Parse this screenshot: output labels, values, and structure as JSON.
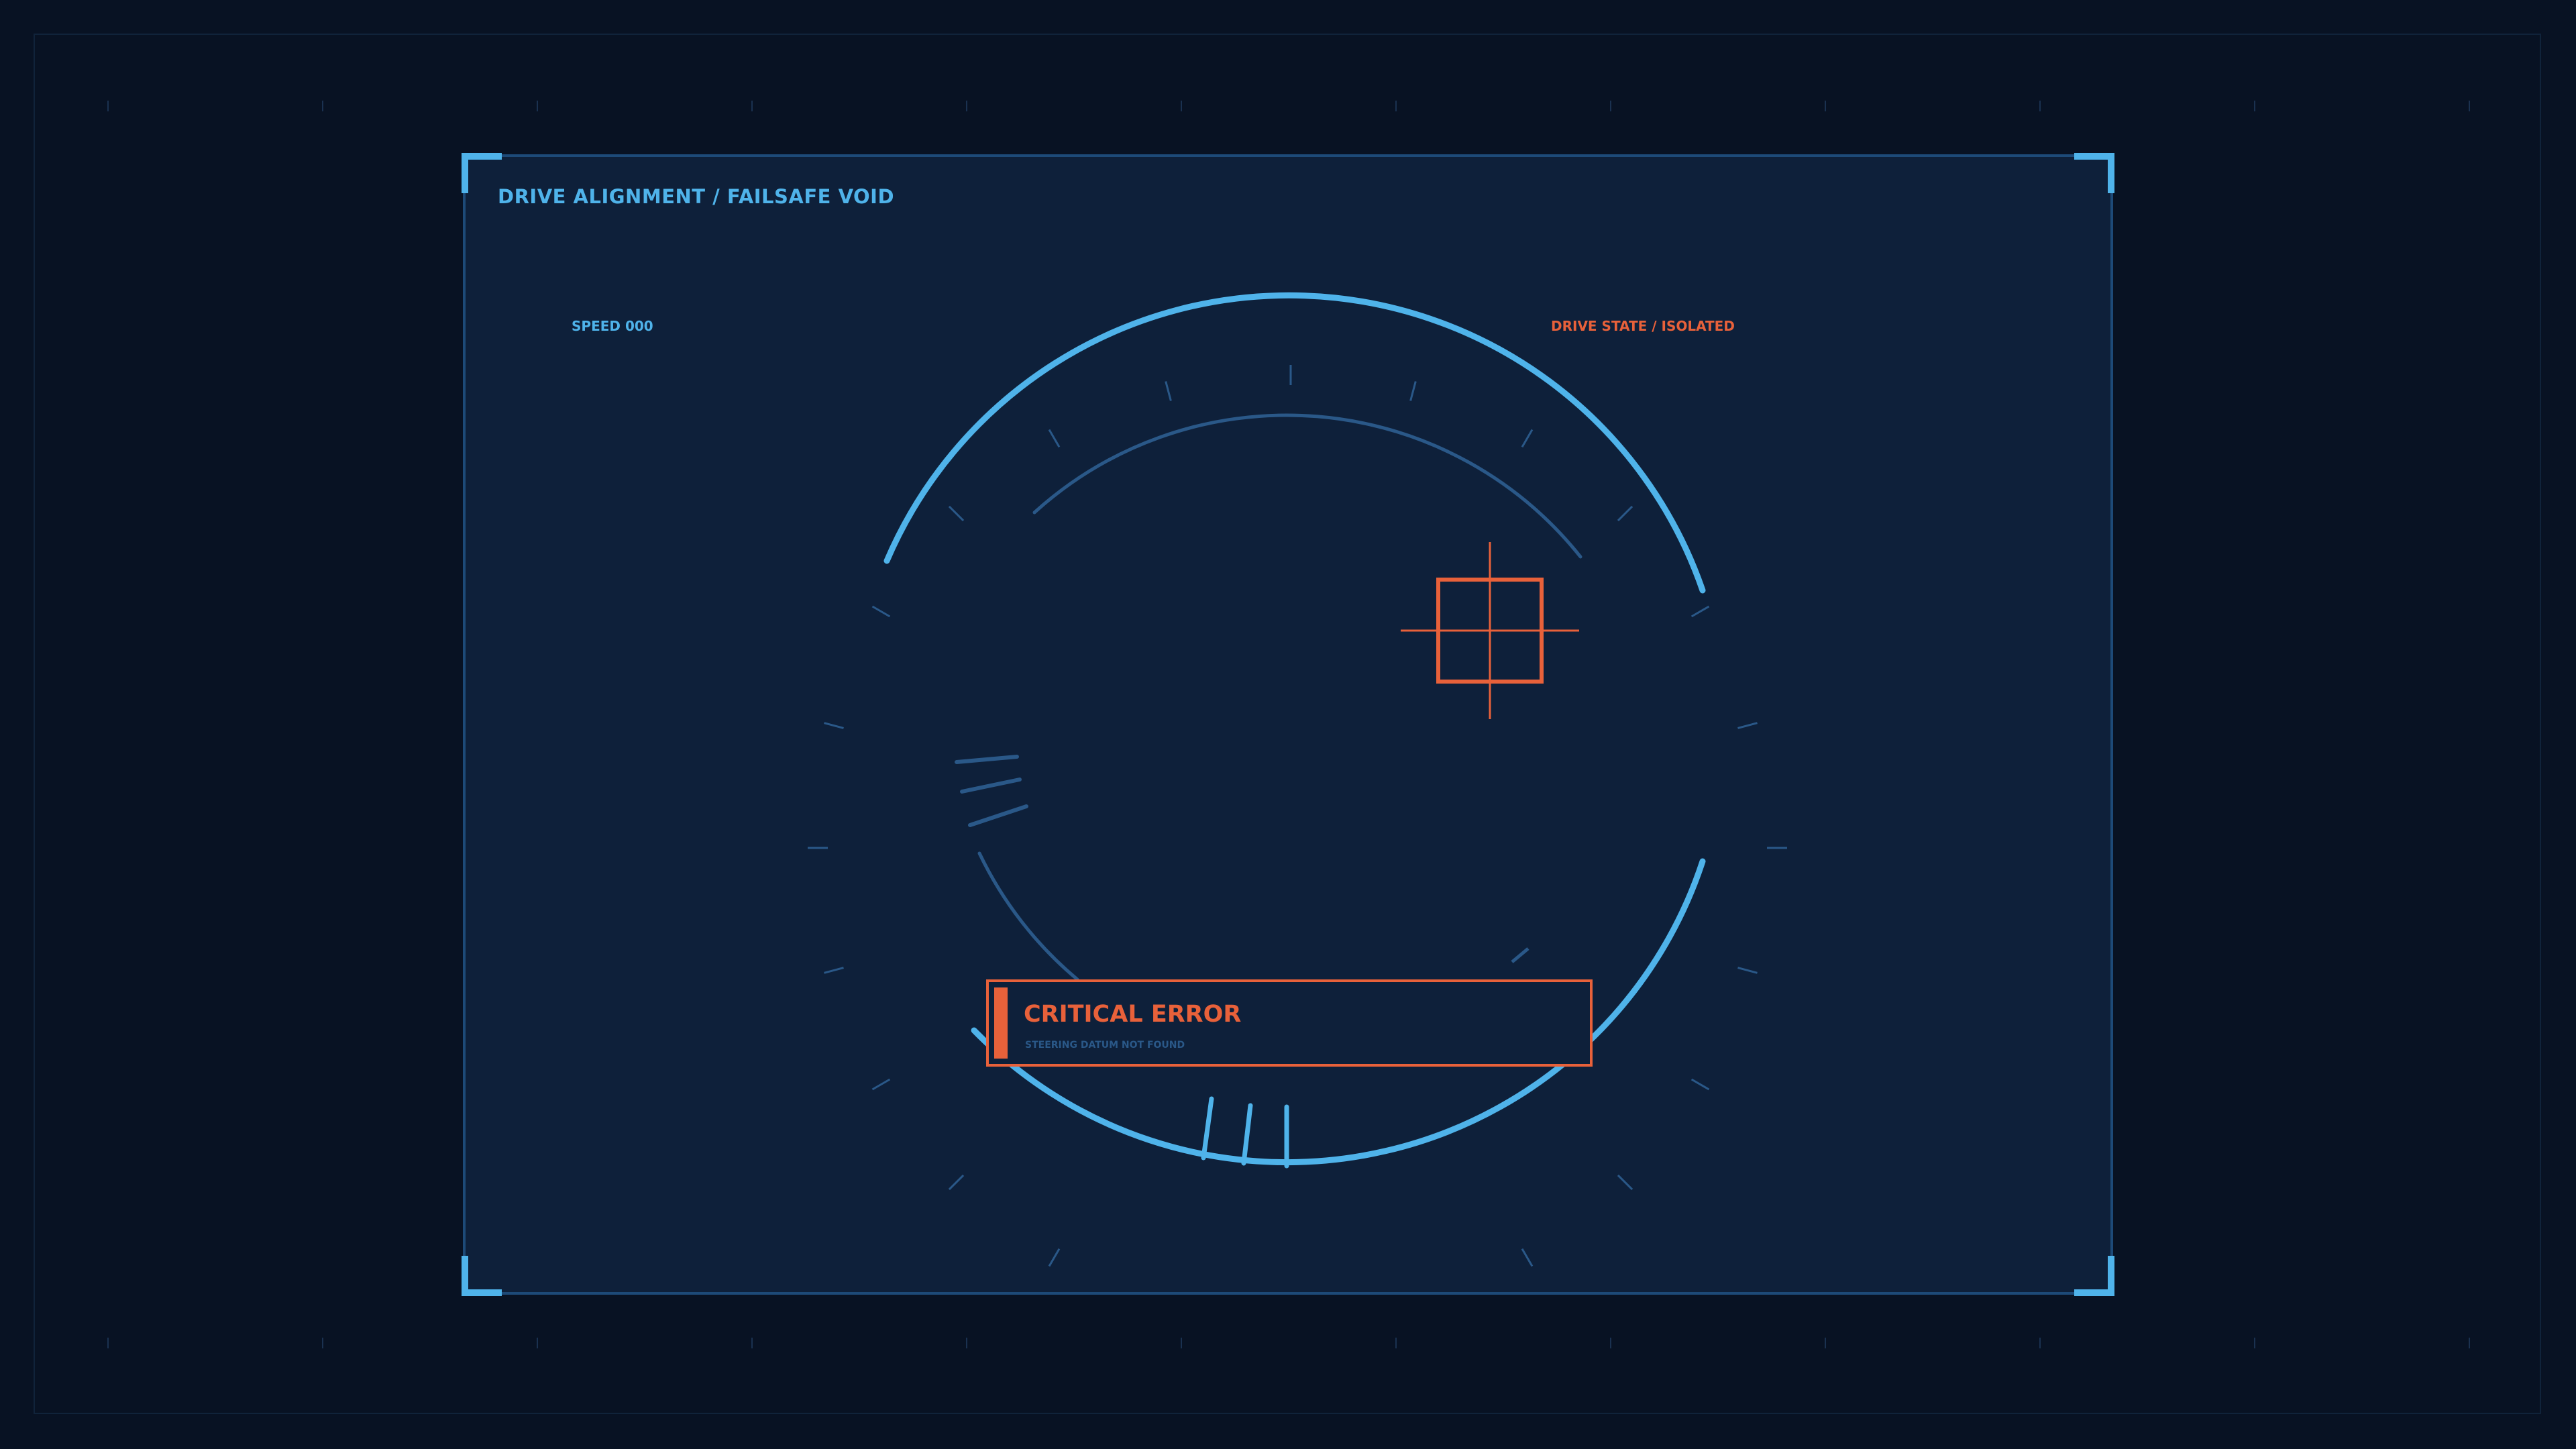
{
  "panel": {
    "title": "DRIVE ALIGNMENT / FAILSAFE VOID"
  },
  "readouts": {
    "speed": "SPEED 000",
    "drive_state": "DRIVE STATE / ISOLATED"
  },
  "alert": {
    "title": "CRITICAL ERROR",
    "message": "STEERING DATUM NOT FOUND"
  },
  "icons": {
    "target": "crosshair-target-icon",
    "speed_lines": "speed-lines-icon"
  },
  "colors": {
    "background": "#081223",
    "panel": "#0e203a",
    "accent": "#4fb3ea",
    "dim_accent": "#2a5888",
    "alert": "#e8613a"
  }
}
